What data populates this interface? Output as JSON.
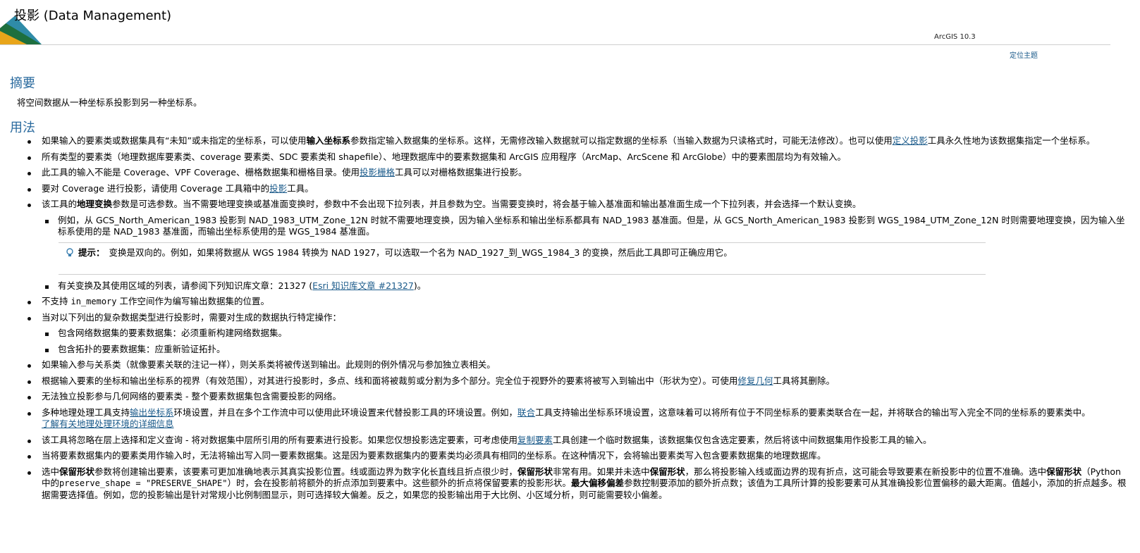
{
  "header": {
    "title": "投影 (Data Management)",
    "version": "ArcGIS 10.3",
    "locate_link": "定位主题"
  },
  "summary": {
    "heading": "摘要",
    "text": "将空间数据从一种坐标系投影到另一种坐标系。"
  },
  "usage": {
    "heading": "用法",
    "b1": {
      "t1": "如果输入的要素类或数据集具有“未知”或未指定的坐标系，可以使用",
      "b": "输入坐标系",
      "t2": "参数指定输入数据集的坐标系。这样，无需修改输入数据就可以指定数据的坐标系（当输入数据为只读格式时，可能无法修改）。也可以使用",
      "link": "定义投影",
      "t3": "工具永久性地为该数据集指定一个坐标系。"
    },
    "b2": "所有类型的要素类（地理数据库要素类、coverage 要素类、SDC 要素类和 shapefile）、地理数据库中的要素数据集和 ArcGIS 应用程序（ArcMap、ArcScene 和 ArcGlobe）中的要素图层均为有效输入。",
    "b3": {
      "t1": "此工具的输入不能是 Coverage、VPF Coverage、栅格数据集和栅格目录。使用",
      "link": "投影栅格",
      "t2": "工具可以对栅格数据集进行投影。"
    },
    "b4": {
      "t1": "要对 Coverage 进行投影，请使用 Coverage 工具箱中的",
      "link": "投影",
      "t2": "工具。"
    },
    "b5": {
      "t1": "该工具的",
      "b": "地理变换",
      "t2": "参数是可选参数。当不需要地理变换或基准面变换时，参数中不会出现下拉列表，并且参数为空。当需要变换时，将会基于输入基准面和输出基准面生成一个下拉列表，并会选择一个默认变换。"
    },
    "b5_sub1": "例如，从 GCS_North_American_1983 投影到 NAD_1983_UTM_Zone_12N 时就不需要地理变换，因为输入坐标系和输出坐标系都具有 NAD_1983 基准面。但是，从 GCS_North_American_1983 投影到 WGS_1984_UTM_Zone_12N 时则需要地理变换，因为输入坐标系使用的是 NAD_1983 基准面，而输出坐标系使用的是 WGS_1984 基准面。",
    "tip": {
      "label": "提示：",
      "text": "变换是双向的。例如，如果将数据从 WGS 1984 转换为 NAD 1927，可以选取一个名为 NAD_1927_到_WGS_1984_3 的变换，然后此工具即可正确应用它。"
    },
    "b5_sub2": {
      "t1": "有关变换及其使用区域的列表，请参阅下列知识库文章：21327 (",
      "link": "Esri 知识库文章 #21327",
      "t2": ")。"
    },
    "b6": {
      "t1": "不支持 ",
      "code": "in_memory",
      "t2": " 工作空间作为编写输出数据集的位置。"
    },
    "b7": "当对以下列出的复杂数据类型进行投影时，需要对生成的数据执行特定操作：",
    "b7_sub1": "包含网络数据集的要素数据集：必须重新构建网络数据集。",
    "b7_sub2": "包含拓扑的要素数据集：应重新验证拓扑。",
    "b8": "如果输入参与关系类（就像要素关联的注记一样），则关系类将被传送到输出。此规则的例外情况与参加独立表相关。",
    "b9": {
      "t1": "根据输入要素的坐标和输出坐标系的视界（有效范围），对其进行投影时，多点、线和面将被裁剪或分割为多个部分。完全位于视野外的要素将被写入到输出中（形状为空）。可使用",
      "link": "修复几何",
      "t2": "工具将其删除。"
    },
    "b10": "无法独立投影参与几何网络的要素类 - 整个要素数据集包含需要投影的网络。",
    "b11": {
      "t1": "多种地理处理工具支持",
      "link1": "输出坐标系",
      "t2": "环境设置，并且在多个工作流中可以使用此环境设置来代替投影工具的环境设置。例如，",
      "link2": "联合",
      "t3": "工具支持输出坐标系环境设置，这意味着可以将所有位于不同坐标系的要素类联合在一起，并将联合的输出写入完全不同的坐标系的要素类中。",
      "link3": "了解有关地理处理环境的详细信息"
    },
    "b12": {
      "t1": "该工具将忽略在层上选择和定义查询 - 将对数据集中层所引用的所有要素进行投影。如果您仅想投影选定要素，可考虑使用",
      "link": "复制要素",
      "t2": "工具创建一个临时数据集，该数据集仅包含选定要素，然后将该中间数据集用作投影工具的输入。"
    },
    "b13": "当将要素数据集内的要素类用作输入时，无法将输出写入同一要素数据集。这是因为要素数据集内的要素类均必须具有相同的坐标系。在这种情况下，会将输出要素类写入包含要素数据集的地理数据库。",
    "b14": {
      "b1": "保留形状",
      "t1": "参数将创建输出要素，该要素可更加准确地表示其真实投影位置。线或面边界为数字化长直线且折点很少时，",
      "b2": "保留形状",
      "t2": "非常有用。如果并未选中",
      "b3": "保留形状",
      "t3": "，那么将投影输入线或面边界的现有折点，这可能会导致要素在新投影中的位置不准确。选中",
      "b4": "保留形状",
      "t4": "（Python 中的",
      "code": "preserve_shape = \"PRESERVE_SHAPE\"",
      "t5": "）时，会在投影前将额外的折点添加到要素中。这些额外的折点将保留要素的投影形状。",
      "b5": "最大偏移偏差",
      "t6": "参数控制要添加的额外折点数；该值为工具所计算的投影要素可从其准确投影位置偏移的最大距离。值越小，添加的折点越多。根据需要选择值。例如，您的投影输出是针对常规小比例制图显示，则可选择较大偏差。反之，如果您的投影输出用于大比例、小区域分析，则可能需要较小偏差。"
    }
  }
}
